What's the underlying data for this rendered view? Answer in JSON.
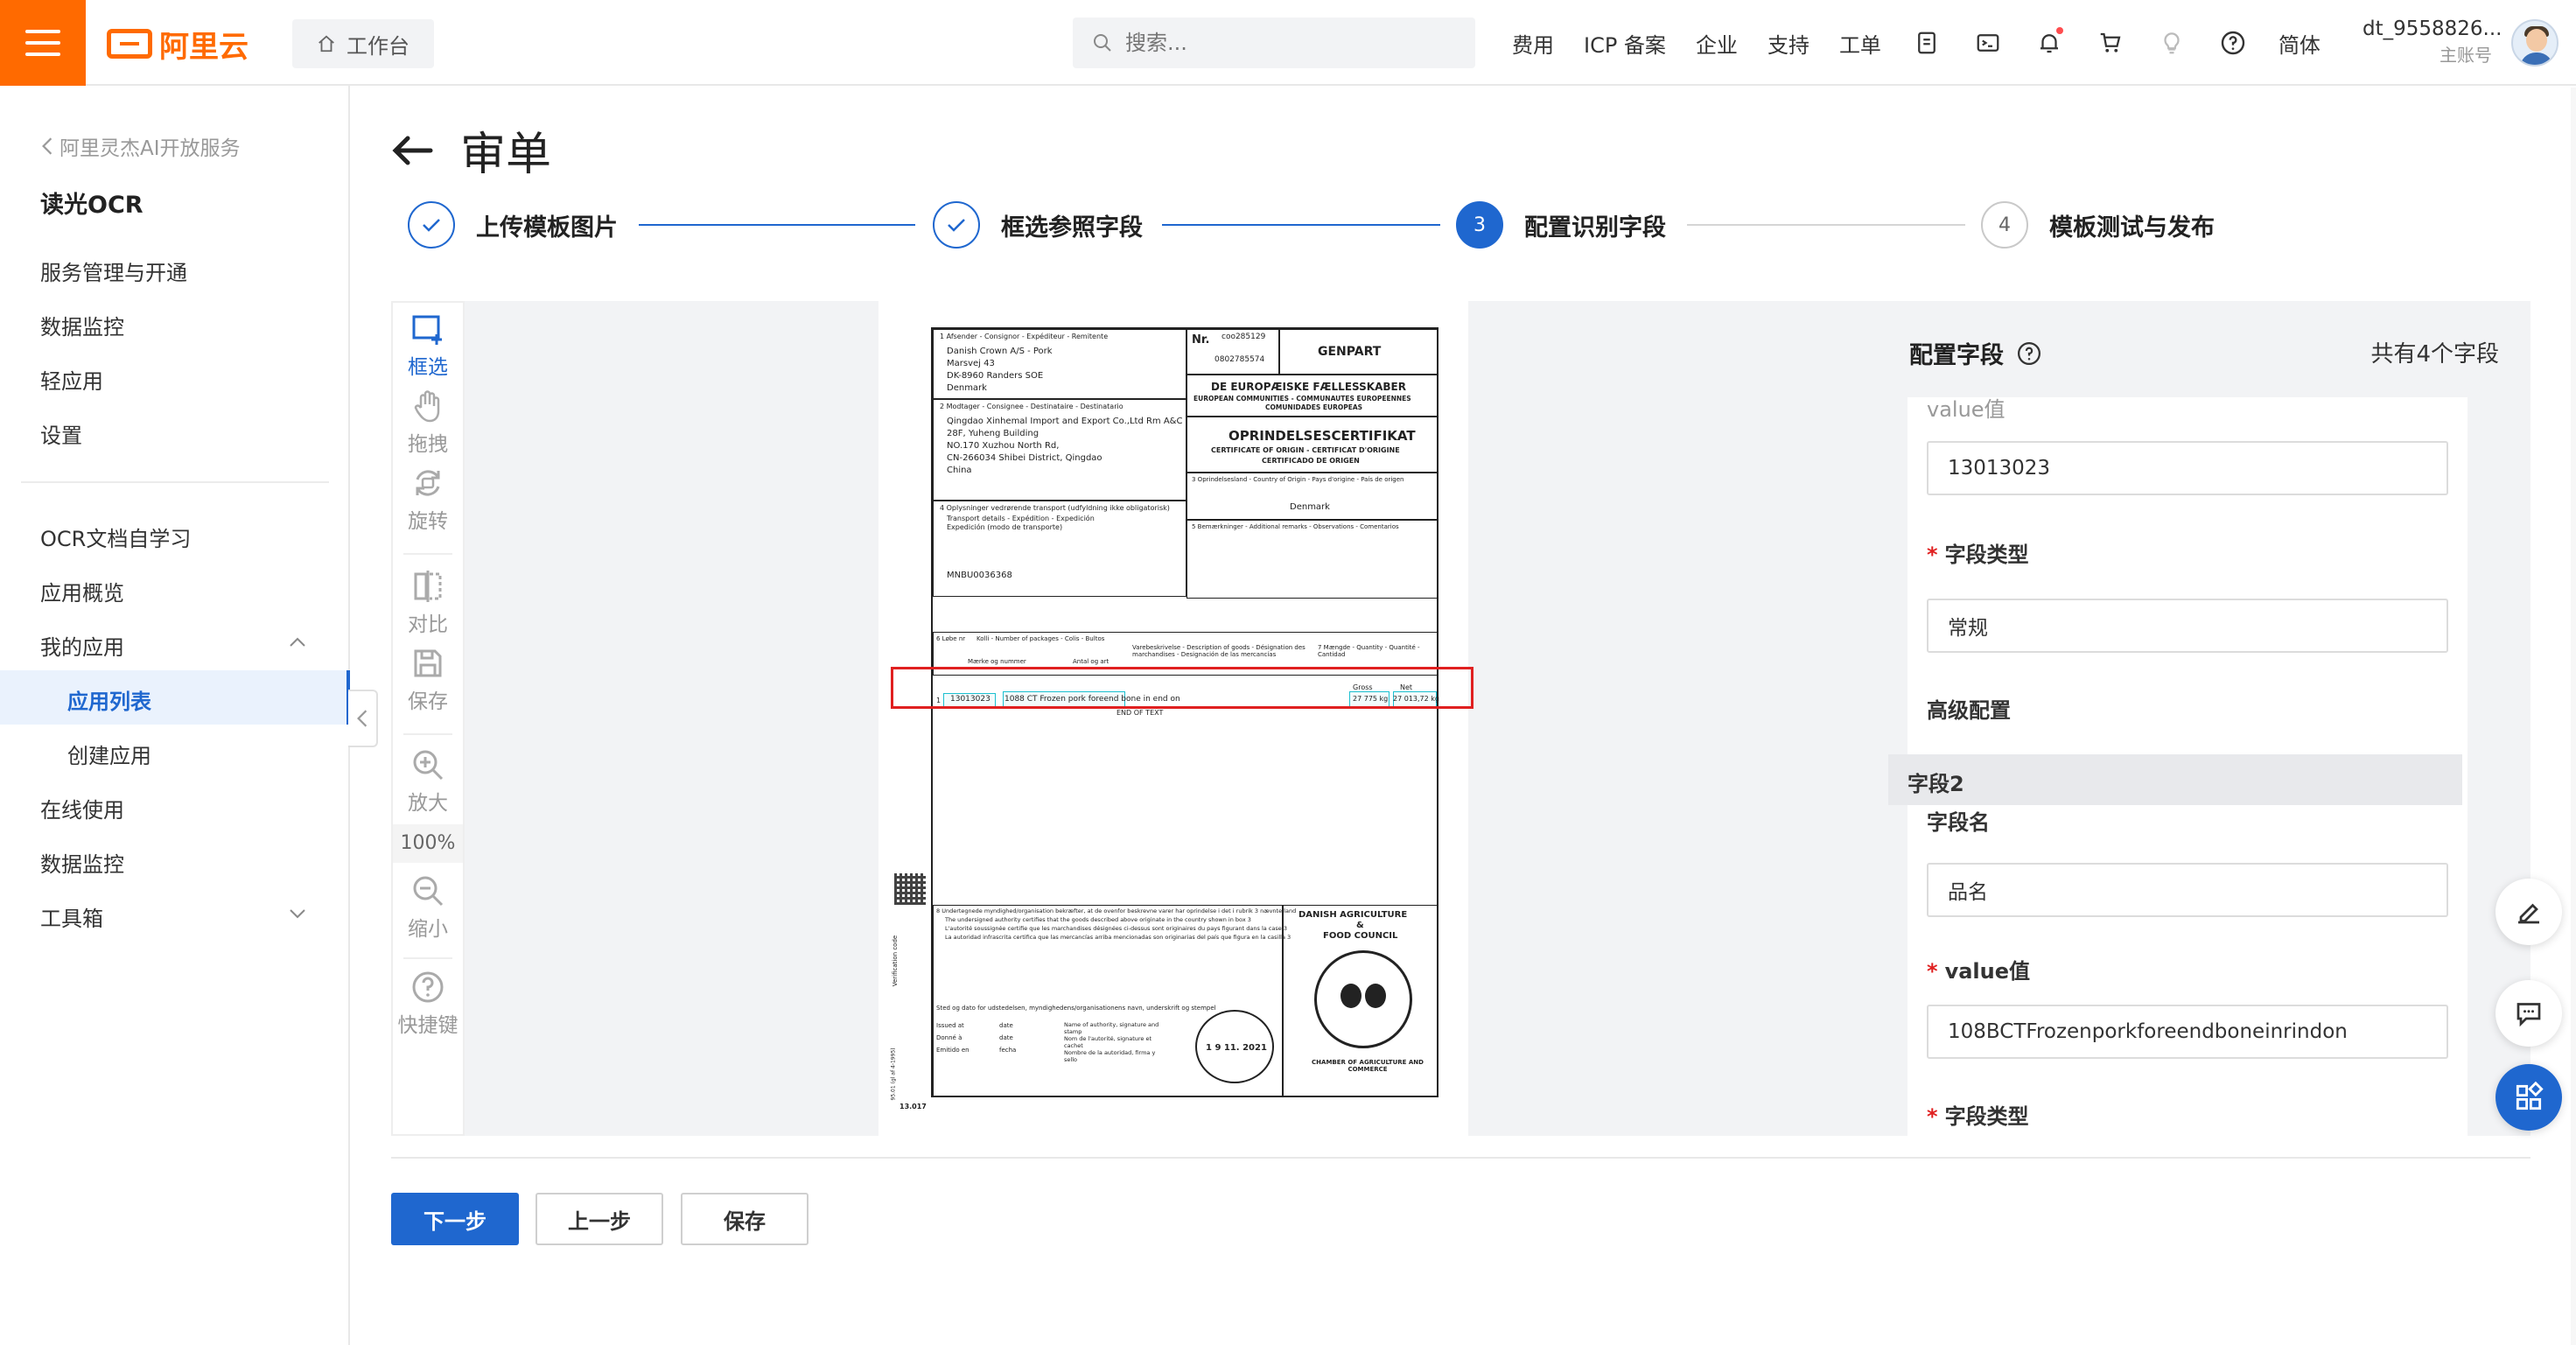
{
  "header": {
    "logo_text": "阿里云",
    "workbench": "工作台",
    "search_placeholder": "搜索...",
    "nav": [
      "费用",
      "ICP 备案",
      "企业",
      "支持",
      "工单"
    ],
    "lang": "简体",
    "user_name": "dt_9558826...",
    "user_role": "主账号"
  },
  "sidebar": {
    "back": "阿里灵杰AI开放服务",
    "product": "读光OCR",
    "group1": [
      "服务管理与开通",
      "数据监控",
      "轻应用",
      "设置"
    ],
    "group2_top": [
      "OCR文档自学习",
      "应用概览"
    ],
    "my_apps": "我的应用",
    "app_list": "应用列表",
    "create_app": "创建应用",
    "group2_bottom": [
      "在线使用",
      "数据监控"
    ],
    "toolbox": "工具箱"
  },
  "page": {
    "title": "审单",
    "steps": [
      {
        "label": "上传模板图片",
        "state": "done"
      },
      {
        "label": "框选参照字段",
        "state": "done"
      },
      {
        "label": "配置识别字段",
        "state": "active",
        "number": "3"
      },
      {
        "label": "模板测试与发布",
        "state": "todo",
        "number": "4"
      }
    ]
  },
  "tools": {
    "select": "框选",
    "drag": "拖拽",
    "rotate": "旋转",
    "compare": "对比",
    "save": "保存",
    "zoom_in": "放大",
    "zoom_value": "100%",
    "zoom_out": "缩小",
    "shortcuts": "快捷键"
  },
  "document": {
    "nr_label": "Nr.",
    "nr_value": "coo285129",
    "nr_value2": "0802785574",
    "genpart": "GENPART",
    "sender_label": "1  Afsender - Consignor - Expéditeur - Remitente",
    "sender": [
      "Danish Crown A/S - Pork",
      "Marsvej 43",
      "DK-8960 Randers SOE",
      "Denmark"
    ],
    "consignee_label": "2  Modtager - Consignee - Destinataire - Destinatario",
    "consignee": [
      "Qingdao Xinhemal Import and Export Co.,Ltd  Rm A&C",
      "28F, Yuheng Building",
      "NO.170 Xuzhou North Rd,",
      "CN-266034 Shibei District, Qingdao",
      "China"
    ],
    "euro_title": "DE EUROPÆISKE FÆLLESSKABER",
    "euro_sub": "EUROPEAN COMMUNITIES - COMMUNAUTES EUROPEENNES",
    "euro_sub2": "COMUNIDADES EUROPEAS",
    "cert_title": "OPRINDELSESCERTIFIKAT",
    "cert_sub": "CERTIFICATE OF ORIGIN - CERTIFICAT D'ORIGINE",
    "cert_sub2": "CERTIFICADO DE ORIGEN",
    "origin_label": "3  Oprindelsesland - Country of Origin - Pays d'origine - País de origen",
    "origin_value": "Denmark",
    "transport_label": "4  Oplysninger vedrørende transport (udfyldning ikke obligatorisk)",
    "transport_sub": "Transport details - Expédition - Expedición",
    "transport_sub2": "Expedición (modo de transporte)",
    "transport_value": "MNBU0036368",
    "remarks_label": "5  Bemærkninger - Additional remarks - Observations - Comentarios",
    "col_marks": "6  Løbe nr",
    "col_kolli": "Kolli - Number of packages - Colis - Bultos",
    "col_marks2": "Mærke og nummer",
    "col_art": "Antal og art",
    "col_desc": "Varebeskrivelse - Description of goods - Désignation des marchandises - Designación de las mercancías",
    "col_qty": "7  Mængde - Quantity - Quantité - Cantidad",
    "gross": "Gross",
    "net": "Net",
    "row_no": "1",
    "row_code": "13013023",
    "row_desc": "1088 CT  Frozen pork foreend bone in end on",
    "row_gross": "27 775 kg",
    "row_net": "27 013,72 kg",
    "end_text": "END OF TEXT",
    "authority": [
      "DANISH AGRICULTURE",
      "&",
      "FOOD COUNCIL"
    ],
    "chamber": "CHAMBER OF AGRICULTURE AND COMMERCE",
    "date_stamp": "1 9  11.  2021",
    "verify": "Verification code",
    "cert_decl": [
      "8  Undertegnede myndighed/organisation bekræfter, at de ovenfor beskrevne varer har oprindelse i det i rubrik 3 nævnte land",
      "The undersigned authority certifies that the goods described above originate in the country shown in box 3",
      "L'autorité soussignée certifie que les marchandises désignées ci-dessus sont originaires du pays figurant dans la case 3",
      "La autoridad infrascrita certifica que las mercancías arriba mencionadas son originarias del país que figura en la casilla 3"
    ],
    "place_label": "Sted og dato for udstedelsen, myndighedens/organisationens navn, underskrift og stempel",
    "issued": [
      "Issued at",
      "Donné à",
      "Emitido en"
    ],
    "dates": [
      "date",
      "date",
      "fecha"
    ],
    "names": [
      "Name of authority, signature and",
      "stamp",
      "Nom de l'autorité, signature et",
      "cachet",
      "Nombre de la autoridad, firma y",
      "sello"
    ],
    "form_code": "13.017",
    "form_side": "95.01 (gl af 4-1995)"
  },
  "config": {
    "title": "配置字段",
    "count": "共有4个字段",
    "cut_label": "value值",
    "field1_value": "13013023",
    "type_label": "字段类型",
    "field1_type": "常规",
    "advanced": "高级配置",
    "group2": "字段2",
    "name_label": "字段名",
    "field2_name": "品名",
    "value_label": "value值",
    "field2_value": "108BCTFrozenporkforeendboneinrindon",
    "type_label2": "字段类型"
  },
  "buttons": {
    "next": "下一步",
    "prev": "上一步",
    "save": "保存"
  },
  "colors": {
    "brand": "#ff6a00",
    "primary": "#1f67cf",
    "highlight": "#e02020"
  }
}
